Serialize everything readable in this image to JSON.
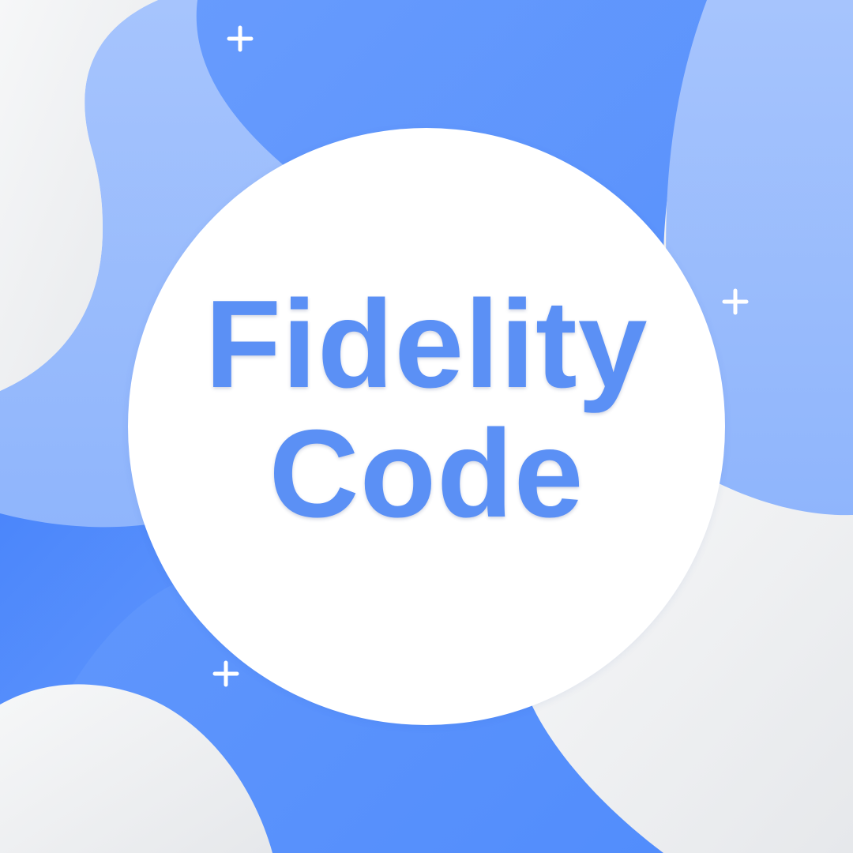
{
  "logo": {
    "line1": "Fidelity",
    "line2": "Code"
  },
  "colors": {
    "brand_text": "#5b90f5",
    "blob_primary": "#5b93fc",
    "blob_light": "#9fc0fc",
    "blob_deep": "#4a87fb",
    "background": "#f0f1f3",
    "circle": "#ffffff"
  },
  "icons": [
    "plus-sparkle-icon",
    "plus-sparkle-icon",
    "plus-sparkle-icon"
  ]
}
